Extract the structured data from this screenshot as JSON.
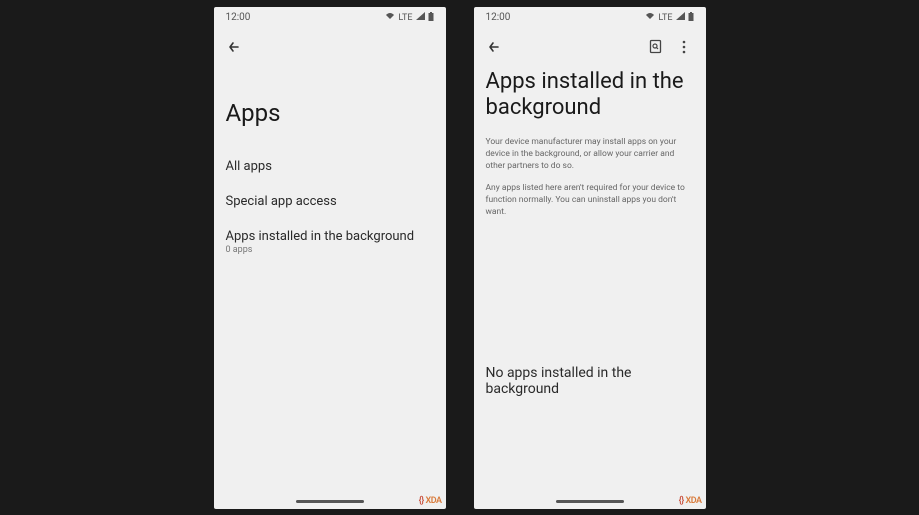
{
  "status": {
    "time": "12:00",
    "network": "LTE"
  },
  "screen1": {
    "title": "Apps",
    "items": [
      {
        "label": "All apps",
        "sub": ""
      },
      {
        "label": "Special app access",
        "sub": ""
      },
      {
        "label": "Apps installed in the background",
        "sub": "0 apps"
      }
    ]
  },
  "screen2": {
    "title": "Apps installed in the background",
    "desc1": "Your device manufacturer may install apps on your device in the background, or allow your carrier and other partners to do so.",
    "desc2": "Any apps listed here aren't required for your device to function normally. You can uninstall apps you don't want.",
    "empty": "No apps installed in the background"
  },
  "watermark": "XDA"
}
